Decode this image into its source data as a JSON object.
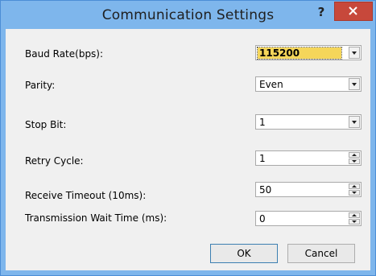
{
  "window": {
    "title": "Communication Settings",
    "help_label": "?"
  },
  "settings": [
    {
      "label": "Baud Rate(bps):",
      "value": "115200",
      "control": "dropdown"
    },
    {
      "label": "Parity:",
      "value": "Even",
      "control": "dropdown"
    },
    {
      "label": "Stop Bit:",
      "value": "1",
      "control": "dropdown"
    },
    {
      "label": "Retry Cycle:",
      "value": "1",
      "control": "spinner"
    },
    {
      "label": "Receive Timeout (10ms):",
      "value": "50",
      "control": "spinner"
    },
    {
      "label": "Transmission Wait Time (ms):",
      "value": "0",
      "control": "spinner"
    }
  ],
  "buttons": {
    "ok": "OK",
    "cancel": "Cancel"
  },
  "colors": {
    "title_bar": "#7eb6ec",
    "close_button": "#c7483b",
    "selection_highlight": "#f5d65a",
    "client_background": "#f0f0f0"
  }
}
